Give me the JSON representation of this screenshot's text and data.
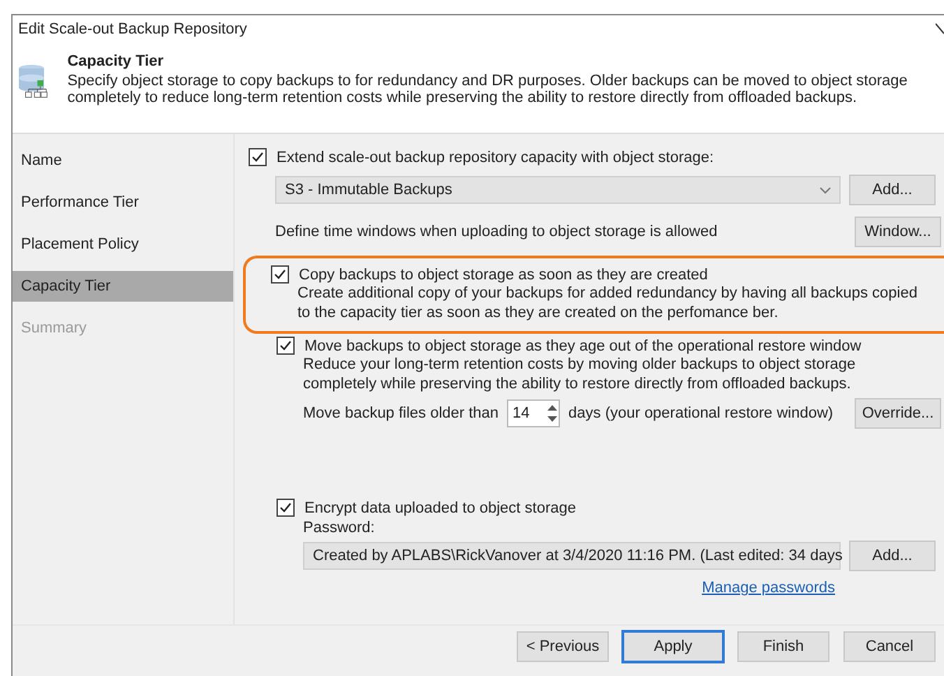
{
  "window": {
    "title": "Edit Scale-out Backup Repository"
  },
  "header": {
    "title": "Capacity Tier",
    "description": "Specify object storage to copy backups to for redundancy and DR purposes. Older backups can be moved to object storage completely to reduce long-term retention costs while preserving the ability to restore directly from offloaded backups."
  },
  "steps": [
    {
      "label": "Name",
      "selected": false,
      "disabled": false
    },
    {
      "label": "Performance Tier",
      "selected": false,
      "disabled": false
    },
    {
      "label": "Placement Policy",
      "selected": false,
      "disabled": false
    },
    {
      "label": "Capacity Tier",
      "selected": true,
      "disabled": false
    },
    {
      "label": "Summary",
      "selected": false,
      "disabled": true
    }
  ],
  "extend": {
    "label": "Extend scale-out backup repository capacity with object storage:",
    "checked": true,
    "repository": "S3 - Immutable Backups",
    "add_button": "Add...",
    "window_text": "Define time windows when uploading to object storage is allowed",
    "window_button": "Window..."
  },
  "copy_option": {
    "label": "Copy backups to object storage as soon as they are created",
    "checked": true,
    "highlighted": true,
    "description": "Create additional copy of your backups for added redundancy by having all backups copied to the capacity tier as soon as they are created on the perfomance ber."
  },
  "move_option": {
    "label": "Move backups to object storage as they age out of the operational restore window",
    "checked": true,
    "description": "Reduce your long-term retention costs by moving older backups to object storage completely while preserving the ability to restore directly from offloaded backups.",
    "older_than_label": "Move backup files older than",
    "days": "14",
    "days_label": "days (your operational restore window)",
    "override_button": "Override..."
  },
  "encrypt": {
    "label": "Encrypt data uploaded to object storage",
    "checked": true,
    "password_label": "Password:",
    "password": "Created by APLABS\\RickVanover at 3/4/2020 11:16 PM. (Last edited: 34 days",
    "add_button": "Add...",
    "manage_link": "Manage passwords"
  },
  "buttons": [
    {
      "label": "< Previous",
      "focused": false
    },
    {
      "label": "Apply",
      "focused": true
    },
    {
      "label": "Finish",
      "focused": false
    },
    {
      "label": "Cancel",
      "focused": false
    }
  ]
}
